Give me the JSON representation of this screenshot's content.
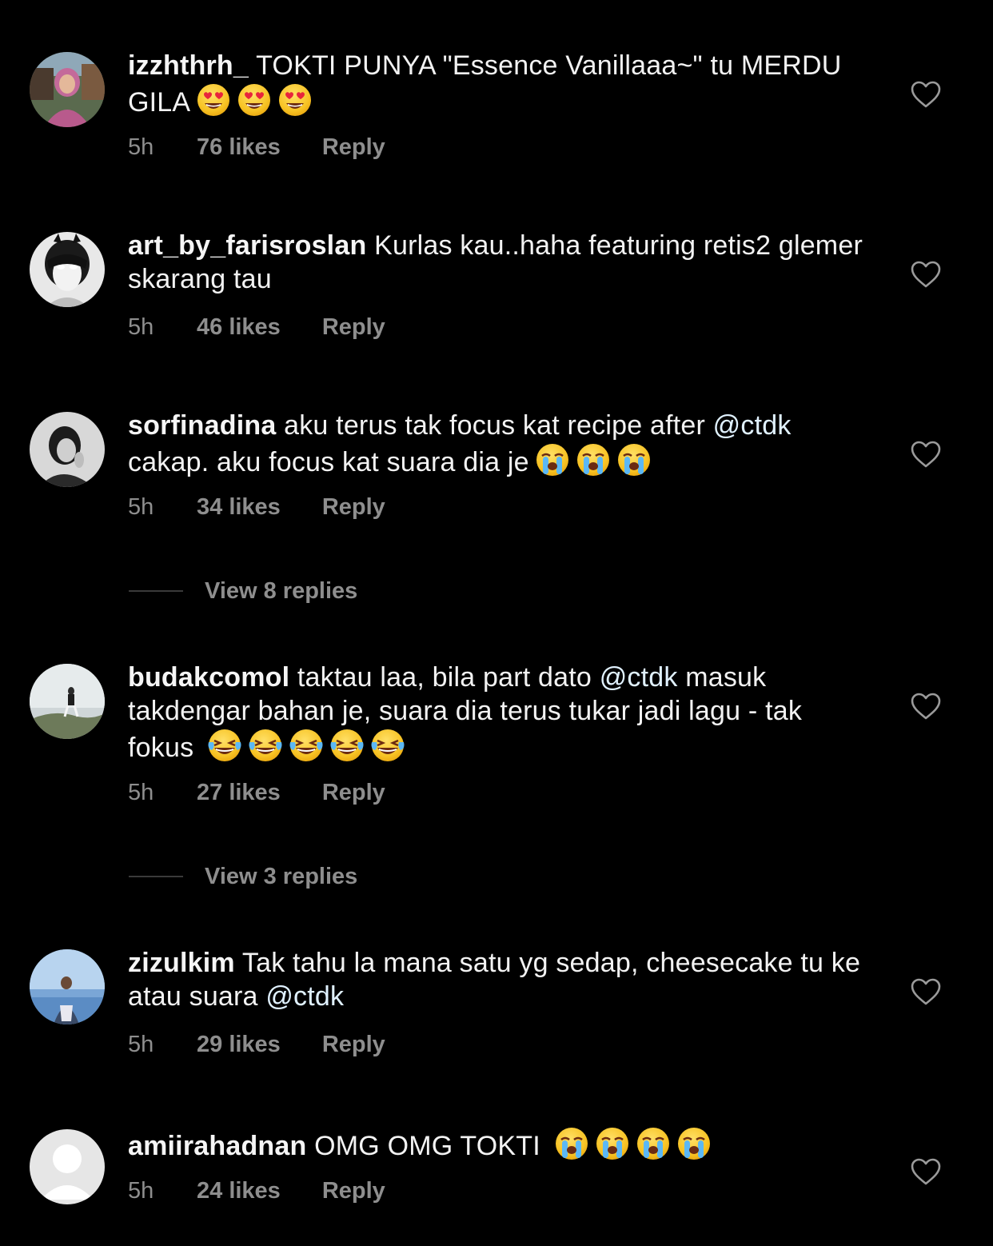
{
  "comments": [
    {
      "username": "izzhthrh_",
      "text_parts": [
        "TOKTI PUNYA \"Essence Vanillaaa~\" tu MERDU GILA"
      ],
      "emoji": [
        "heart-eyes",
        "heart-eyes",
        "heart-eyes"
      ],
      "time": "5h",
      "likes": "76 likes",
      "reply": "Reply"
    },
    {
      "username": "art_by_farisroslan",
      "text_parts": [
        "Kurlas kau..haha featuring retis2 glemer skarang tau"
      ],
      "time": "5h",
      "likes": "46 likes",
      "reply": "Reply"
    },
    {
      "username": "sorfinadina",
      "text_a": "aku terus tak focus kat recipe after",
      "mention": "@ctdk",
      "text_b": "cakap. aku focus kat suara dia je",
      "emoji": [
        "crying",
        "crying",
        "crying"
      ],
      "time": "5h",
      "likes": "34 likes",
      "reply": "Reply",
      "view_replies": "View 8 replies"
    },
    {
      "username": "budakcomol",
      "text_a": "taktau laa, bila part dato",
      "mention": "@ctdk",
      "text_b": "masuk takdengar bahan je, suara dia terus tukar jadi lagu - tak fokus",
      "emoji": [
        "laughing-tears",
        "laughing-tears",
        "laughing-tears",
        "laughing-tears",
        "laughing-tears"
      ],
      "time": "5h",
      "likes": "27 likes",
      "reply": "Reply",
      "view_replies": "View 3 replies"
    },
    {
      "username": "zizulkim",
      "text_a": "Tak tahu la mana satu yg sedap, cheesecake tu ke atau suara",
      "mention": "@ctdk",
      "time": "5h",
      "likes": "29 likes",
      "reply": "Reply"
    },
    {
      "username": "amiirahadnan",
      "text_a": "OMG OMG TOKTI",
      "emoji": [
        "crying",
        "crying",
        "crying",
        "crying"
      ],
      "time": "5h",
      "likes": "24 likes",
      "reply": "Reply"
    }
  ],
  "colors": {
    "background": "#000000",
    "text": "#f2f2f2",
    "secondary_text": "#8e8e8e",
    "mention": "#e0f1ff"
  }
}
